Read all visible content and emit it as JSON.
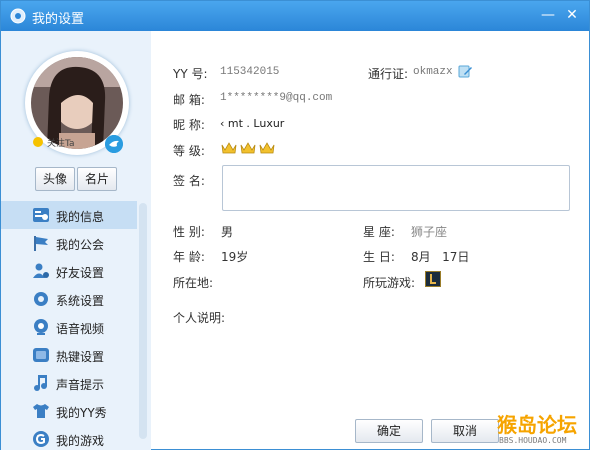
{
  "window": {
    "title": "我的设置",
    "title_icon": "gear-icon",
    "minimize_glyph": "—",
    "close_glyph": "✕"
  },
  "profile": {
    "follow_text": "关注Ta",
    "button_avatar": "头像",
    "button_card": "名片"
  },
  "nav": {
    "items": [
      {
        "label": "我的信息",
        "icon": "profile-card-icon",
        "active": true
      },
      {
        "label": "我的公会",
        "icon": "flag-icon",
        "active": false
      },
      {
        "label": "好友设置",
        "icon": "friends-gear-icon",
        "active": false
      },
      {
        "label": "系统设置",
        "icon": "gear-icon",
        "active": false
      },
      {
        "label": "语音视频",
        "icon": "webcam-icon",
        "active": false
      },
      {
        "label": "热键设置",
        "icon": "hotkey-icon",
        "active": false
      },
      {
        "label": "声音提示",
        "icon": "music-note-icon",
        "active": false
      },
      {
        "label": "我的YY秀",
        "icon": "shirt-icon",
        "active": false
      },
      {
        "label": "我的游戏",
        "icon": "game-icon",
        "active": false
      }
    ]
  },
  "info": {
    "yy_label": "YY 号:",
    "yy_value": "115342015",
    "pass_label": "通行证:",
    "pass_value": "okmazx",
    "email_label": "邮  箱:",
    "email_value": "1********9@qq.com",
    "nick_label": "昵  称:",
    "nick_value": "‹ mt . Luxur",
    "level_label": "等  级:",
    "sign_label": "签  名:",
    "sign_value": "",
    "gender_label": "性  别:",
    "gender_value": "男",
    "zodiac_label": "星  座:",
    "zodiac_value": "狮子座",
    "age_label": "年  龄:",
    "age_value": "19岁",
    "birthday_label": "生  日:",
    "birthday_value": "8月   17日",
    "location_label": "所在地:",
    "games_label": "所玩游戏:",
    "desc_label": "个人说明:"
  },
  "footer": {
    "ok": "确定",
    "cancel": "取消"
  },
  "watermark": {
    "main": "猴岛论坛",
    "sub": "BBS.HOUDAO.COM"
  },
  "colors": {
    "titlebar": "#2b86d8",
    "sidebar_bg": "#e9f2fb",
    "active_item": "#c6def4",
    "crown": "#f2c12e"
  }
}
